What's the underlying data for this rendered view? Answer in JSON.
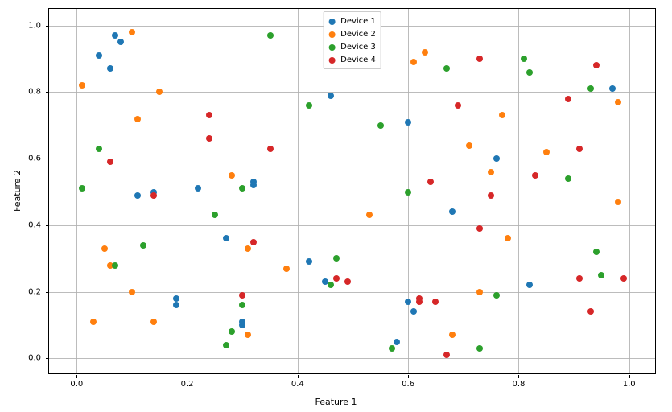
{
  "chart_data": {
    "type": "scatter",
    "xlabel": "Feature 1",
    "ylabel": "Feature 2",
    "title": "",
    "xlim": [
      -0.05,
      1.05
    ],
    "ylim": [
      -0.05,
      1.05
    ],
    "xticks": [
      0.0,
      0.2,
      0.4,
      0.6,
      0.8,
      1.0
    ],
    "yticks": [
      0.0,
      0.2,
      0.4,
      0.6,
      0.8,
      1.0
    ],
    "xtick_labels": [
      "0.0",
      "0.2",
      "0.4",
      "0.6",
      "0.8",
      "1.0"
    ],
    "ytick_labels": [
      "0.0",
      "0.2",
      "0.4",
      "0.6",
      "0.8",
      "1.0"
    ],
    "grid": true,
    "legend_position": "upper center",
    "colors": {
      "Device 1": "#1f77b4",
      "Device 2": "#ff7f0e",
      "Device 3": "#2ca02c",
      "Device 4": "#d62728"
    },
    "series": [
      {
        "name": "Device 1",
        "x": [
          0.06,
          0.97,
          0.04,
          0.11,
          0.6,
          0.14,
          0.22,
          0.18,
          0.82,
          0.46,
          0.07,
          0.68,
          0.42,
          0.32,
          0.61,
          0.18,
          0.58,
          0.3,
          0.6,
          0.32,
          0.76,
          0.27,
          0.08,
          0.45,
          0.3
        ],
        "y": [
          0.87,
          0.81,
          0.91,
          0.49,
          0.71,
          0.5,
          0.51,
          0.18,
          0.22,
          0.79,
          0.97,
          0.44,
          0.29,
          0.53,
          0.14,
          0.16,
          0.05,
          0.1,
          0.17,
          0.52,
          0.6,
          0.36,
          0.95,
          0.23,
          0.11
        ]
      },
      {
        "name": "Device 2",
        "x": [
          0.1,
          0.71,
          0.31,
          0.77,
          0.15,
          0.63,
          0.38,
          0.98,
          0.75,
          0.03,
          0.01,
          0.98,
          0.31,
          0.68,
          0.85,
          0.28,
          0.73,
          0.05,
          0.1,
          0.78,
          0.11,
          0.61,
          0.53,
          0.06,
          0.14
        ],
        "y": [
          0.98,
          0.64,
          0.33,
          0.73,
          0.8,
          0.92,
          0.27,
          0.77,
          0.56,
          0.11,
          0.82,
          0.47,
          0.07,
          0.07,
          0.62,
          0.55,
          0.2,
          0.33,
          0.2,
          0.36,
          0.72,
          0.89,
          0.43,
          0.28,
          0.11
        ]
      },
      {
        "name": "Device 3",
        "x": [
          0.25,
          0.94,
          0.35,
          0.01,
          0.47,
          0.95,
          0.42,
          0.3,
          0.89,
          0.27,
          0.12,
          0.28,
          0.6,
          0.93,
          0.46,
          0.76,
          0.82,
          0.81,
          0.04,
          0.57,
          0.55,
          0.3,
          0.67,
          0.07,
          0.73
        ],
        "y": [
          0.43,
          0.32,
          0.97,
          0.51,
          0.3,
          0.25,
          0.76,
          0.16,
          0.54,
          0.04,
          0.34,
          0.08,
          0.5,
          0.81,
          0.22,
          0.19,
          0.86,
          0.9,
          0.63,
          0.03,
          0.7,
          0.51,
          0.87,
          0.28,
          0.03
        ]
      },
      {
        "name": "Device 4",
        "x": [
          0.67,
          0.93,
          0.35,
          0.91,
          0.64,
          0.94,
          0.65,
          0.47,
          0.83,
          0.49,
          0.73,
          0.24,
          0.24,
          0.32,
          0.3,
          0.62,
          0.73,
          0.69,
          0.62,
          0.14,
          0.89,
          0.75,
          0.06,
          0.91,
          0.99
        ],
        "y": [
          0.01,
          0.14,
          0.63,
          0.24,
          0.53,
          0.88,
          0.17,
          0.24,
          0.55,
          0.23,
          0.9,
          0.66,
          0.73,
          0.35,
          0.19,
          0.18,
          0.39,
          0.76,
          0.17,
          0.49,
          0.78,
          0.49,
          0.59,
          0.63,
          0.24
        ]
      }
    ]
  },
  "legend": {
    "items": [
      "Device 1",
      "Device 2",
      "Device 3",
      "Device 4"
    ]
  }
}
